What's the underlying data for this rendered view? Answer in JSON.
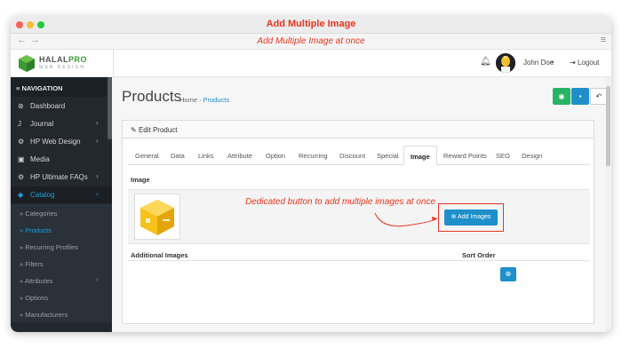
{
  "window": {
    "title": "Add Multiple Image",
    "url_caption": "Add Multiple Image at once",
    "dot_colors": [
      "#fe5f57",
      "#febc2e",
      "#28c840"
    ],
    "accent": "#e8351e"
  },
  "header": {
    "logo_text_a": "HALAL",
    "logo_text_b": "PRO",
    "logo_sub": "WEB DESIGN",
    "user_name": "John Doe",
    "logout_label": "Logout"
  },
  "sidebar": {
    "nav_title": "NAVIGATION",
    "items": [
      {
        "label": "Dashboard",
        "icon": "dashboard-icon"
      },
      {
        "label": "Journal",
        "icon": "journal-icon"
      },
      {
        "label": "HP Web Design",
        "icon": "puzzle-icon"
      },
      {
        "label": "Media",
        "icon": "image-icon"
      },
      {
        "label": "HP Ultimate FAQs",
        "icon": "puzzle-icon"
      },
      {
        "label": "Catalog",
        "icon": "tag-icon"
      }
    ],
    "catalog_sub": [
      {
        "label": "Categories"
      },
      {
        "label": "Products"
      },
      {
        "label": "Recurring Profiles"
      },
      {
        "label": "Filters"
      },
      {
        "label": "Attributes"
      },
      {
        "label": "Options"
      },
      {
        "label": "Manufacturers"
      }
    ],
    "accent": "#1e9fd9"
  },
  "page": {
    "title": "Products",
    "breadcrumb": [
      {
        "label": "Home"
      },
      {
        "label": "Products"
      }
    ],
    "buttons": {
      "preview_color": "#28b463",
      "save_color": "#1e8fc9"
    }
  },
  "panel": {
    "title": "Edit Product",
    "tabs": [
      {
        "label": "General"
      },
      {
        "label": "Data"
      },
      {
        "label": "Links"
      },
      {
        "label": "Attribute"
      },
      {
        "label": "Option"
      },
      {
        "label": "Recurring"
      },
      {
        "label": "Discount"
      },
      {
        "label": "Special"
      },
      {
        "label": "Image"
      },
      {
        "label": "Reward Points"
      },
      {
        "label": "SEO"
      },
      {
        "label": "Design"
      }
    ],
    "image_label": "Image",
    "annotation": "Dedicated button to add multiple images at once",
    "add_images_label": "Add Images",
    "additional_images_label": "Additional Images",
    "sort_order_label": "Sort Order"
  }
}
